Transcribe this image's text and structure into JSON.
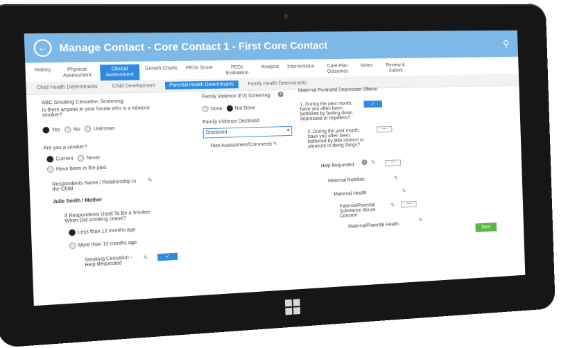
{
  "header": {
    "title": "Manage Contact - Core Contact 1 - First Core Contact"
  },
  "tabs": [
    "History",
    "Physical Assessment",
    "Clinical Assessment",
    "Growth Charts",
    "PEDs Score",
    "PEDs Evaluation",
    "Analysis",
    "Interventions",
    "Care Plan Outcomes",
    "Notes",
    "Review & Submit"
  ],
  "active_tab": "Clinical Assessment",
  "subtabs": [
    "Child Health Determinants",
    "Child Development",
    "Parental Health Determinants",
    "Family Health Determinants"
  ],
  "active_subtab": "Parental Health Determinants",
  "left": {
    "q1_title": "ABC Smoking Cessation Screening",
    "q1_text": "Is there anyone in your house who is a tobacco smoker?",
    "q1_options": [
      "Yes",
      "No",
      "Unknown"
    ],
    "q2_text": "Are you a smoker?",
    "q2_options": [
      "Current",
      "Never",
      "Have been in the past"
    ],
    "respondent_label": "Respondents Name / Relationship to the Child",
    "respondent_value": "Julie Smith / Mother",
    "q3_text": "If Respondents Used To Be a Smoker When Did smoking cease?",
    "q3_options": [
      "Less than 12 months ago",
      "More than 12 months ago"
    ],
    "help_label": "Smoking Cessation - Help Requested"
  },
  "middle": {
    "fv_screening": "Family Violence (FV) Screening",
    "fv_options": [
      "Done",
      "Not Done"
    ],
    "fv_disclosed_label": "Family Violence Disclosed",
    "fv_disclosed_value": "Disclosed",
    "risk_label": "Risk Assessment/Comments"
  },
  "right": {
    "title": "Maternal Postnatal Depression Screen",
    "q1": "1. During the past month, have you often been bothered by feeling down, depressed or hopeless?",
    "q2": "2. During the past month, have you often been bothered by little interest or pleasure in doing things?",
    "help_requested": "Help Requested",
    "maternal_nutrition": "Maternal Nutrition",
    "maternal_health": "Maternal Health",
    "substance_abuse": "Paternal/Parental Substance Abuse Concern",
    "parental_health": "Maternal/Parental Health",
    "next_label": "Next"
  },
  "colors": {
    "header": "#7db8e6",
    "accent": "#2f8ae0",
    "next": "#58b847"
  }
}
